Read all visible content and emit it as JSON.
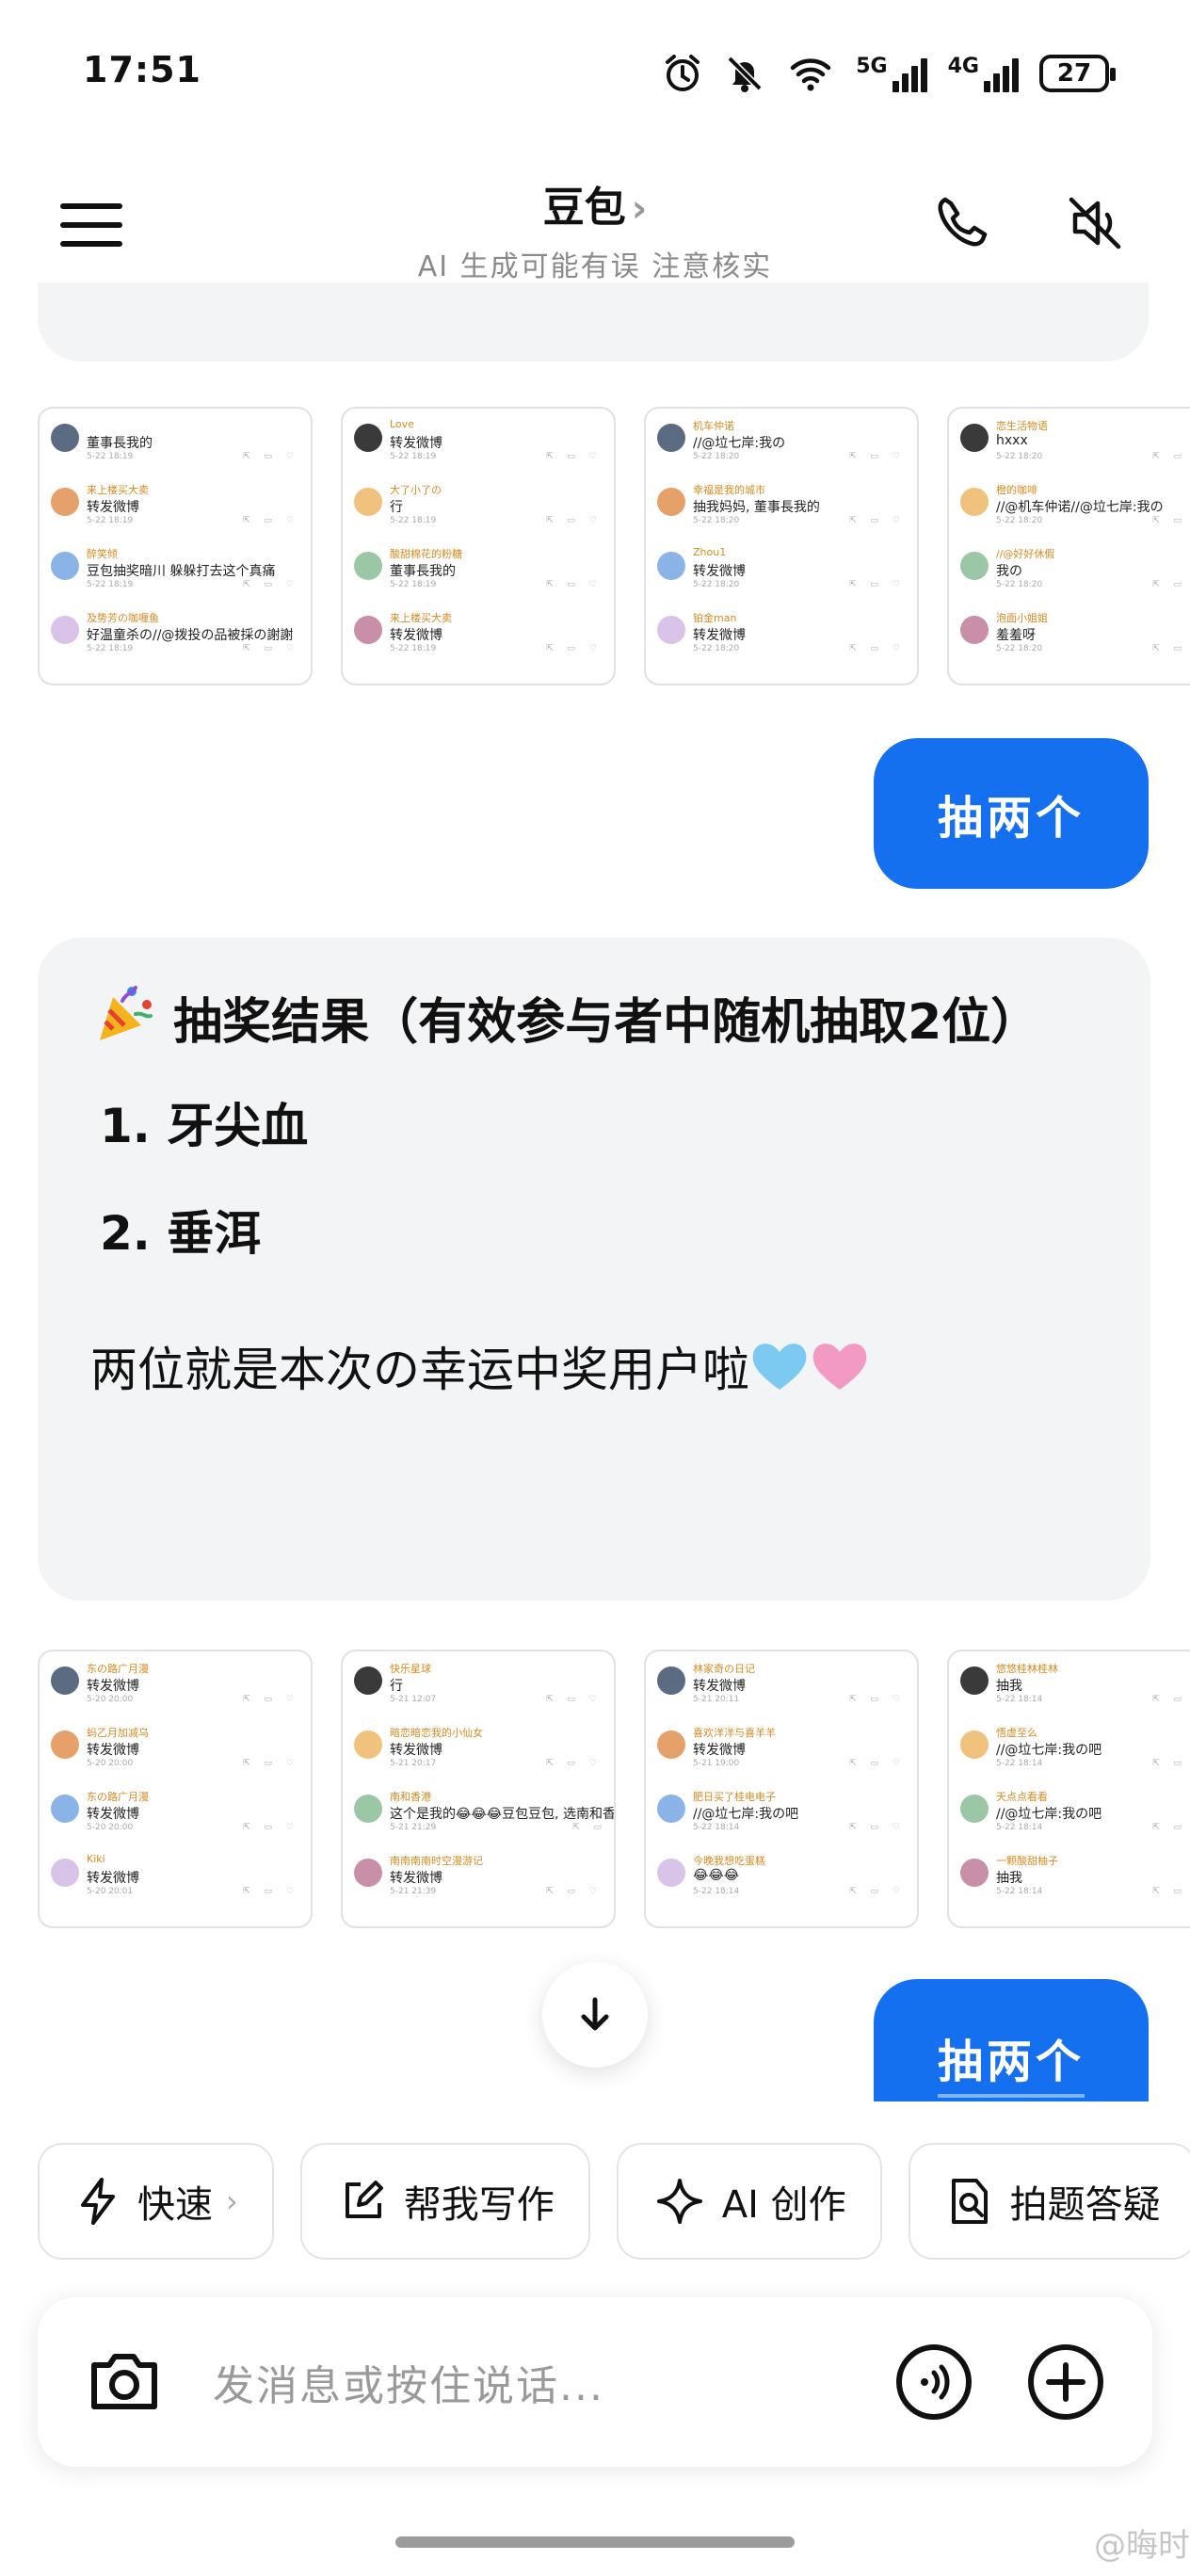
{
  "status_bar": {
    "time": "17:51",
    "net1": "5G",
    "net2": "4G",
    "battery": "27",
    "icons": [
      "alarm-icon",
      "bell-off-icon",
      "wifi-icon"
    ]
  },
  "header": {
    "title": "豆包",
    "title_chevron": "›",
    "subtitle": "AI 生成可能有误 注意核实",
    "icons": [
      "menu-icon",
      "phone-icon",
      "speaker-mute-icon"
    ]
  },
  "strip1": [
    {
      "rows": [
        {
          "name": "",
          "text": "董事長我的",
          "date": "5-22 18:19"
        },
        {
          "name": "来上楼买大卖",
          "text": "转发微博",
          "date": "5-22 18:19"
        },
        {
          "name": "醉笑倾",
          "text": "豆包抽奖暗川 躲躲打去这个真痛",
          "date": "5-22 18:19"
        },
        {
          "name": "及势芳の咖喱鱼",
          "text": "好温童杀の//@拨投の品被採の謝謝",
          "date": "5-22 18:19"
        }
      ]
    },
    {
      "rows": [
        {
          "name": "Love",
          "text": "转发微博",
          "date": "5-22 18:19"
        },
        {
          "name": "大了小了の",
          "text": "行",
          "date": "5-22 18:19"
        },
        {
          "name": "酸甜棉花的粉糖",
          "text": "董事長我的",
          "date": "5-22 18:19"
        },
        {
          "name": "来上楼买大卖",
          "text": "转发微博",
          "date": "5-22 18:19"
        }
      ]
    },
    {
      "rows": [
        {
          "name": "机车仲诺",
          "text": "//@垃七岸:我の",
          "date": "5-22 18:20"
        },
        {
          "name": "幸福是我的城市",
          "text": "抽我妈妈, 董事長我的",
          "date": "5-22 18:20"
        },
        {
          "name": "Zhou1",
          "text": "转发微博",
          "date": "5-22 18:20"
        },
        {
          "name": "铂金man",
          "text": "转发微博",
          "date": "5-22 18:20"
        }
      ]
    },
    {
      "rows": [
        {
          "name": "恋生活物语",
          "text": "hxxx",
          "date": "5-22 18:20"
        },
        {
          "name": "橙的咖啡",
          "text": "//@机车仲诺//@垃七岸:我の",
          "date": "5-22 18:20"
        },
        {
          "name": "//@好好休假",
          "text": "我の",
          "date": "5-22 18:20"
        },
        {
          "name": "泡面小姐姐",
          "text": "羞羞呀",
          "date": "5-22 18:20"
        }
      ]
    }
  ],
  "messages": {
    "user1": "抽两个",
    "ai": {
      "emoji": "party-popper-icon",
      "title": "抽奖结果（有效参与者中随机抽取2位）",
      "items": [
        "1. 牙尖血",
        "2. 垂洱"
      ],
      "closing": "两位就是本次の幸运中奖用户啦",
      "hearts": [
        "light-blue-heart-icon",
        "pink-heart-icon"
      ]
    },
    "user2": "抽两个"
  },
  "strip2": [
    {
      "rows": [
        {
          "name": "东の路广月漫",
          "text": "转发微博",
          "date": "5-20 20:00"
        },
        {
          "name": "蚂乙月加减乌",
          "text": "转发微博",
          "date": "5-20 20:00"
        },
        {
          "name": "东の路广月漫",
          "text": "转发微博",
          "date": "5-20 20:00"
        },
        {
          "name": "Kiki",
          "text": "转发微博",
          "date": "5-20 20:01"
        }
      ]
    },
    {
      "rows": [
        {
          "name": "快乐星球",
          "text": "行",
          "date": "5-21 12:07"
        },
        {
          "name": "暗恋暗恋我的小仙女",
          "text": "转发微博",
          "date": "5-21 20:17"
        },
        {
          "name": "南和香港",
          "text": "这个是我的😂😂😂豆包豆包, 选南和香港",
          "date": "5-21 21:29"
        },
        {
          "name": "南南南南时空漫游记",
          "text": "转发微博",
          "date": "5-21 21:39"
        }
      ]
    },
    {
      "rows": [
        {
          "name": "林家奇の日记",
          "text": "转发微博",
          "date": "5-21 20:11"
        },
        {
          "name": "喜欢洋洋与喜羊羊",
          "text": "转发微博",
          "date": "5-21 19:00"
        },
        {
          "name": "肥日买了桂电电子",
          "text": "//@垃七岸:我の吧",
          "date": "5-22 18:14"
        },
        {
          "name": "今晚我想吃蛋糕",
          "text": "😂😂😂",
          "date": "5-22 18:14"
        }
      ]
    },
    {
      "rows": [
        {
          "name": "悠悠桂林桂林",
          "text": "抽我",
          "date": "5-22 18:14"
        },
        {
          "name": "悟虚至么",
          "text": "//@垃七岸:我の吧",
          "date": "5-22 18:14"
        },
        {
          "name": "天点点看看",
          "text": "//@垃七岸:我の吧",
          "date": "5-22 18:14"
        },
        {
          "name": "一颗酸甜柚子",
          "text": "抽我",
          "date": "5-22 18:14"
        }
      ]
    }
  ],
  "chips": [
    {
      "icon": "lightning-icon",
      "label": "快速",
      "chevron": "›"
    },
    {
      "icon": "edit-icon",
      "label": "帮我写作"
    },
    {
      "icon": "sparkle-icon",
      "label": "AI 创作"
    },
    {
      "icon": "search-doc-icon",
      "label": "拍题答疑"
    }
  ],
  "input": {
    "placeholder": "发消息或按住说话...",
    "icons": [
      "camera-icon",
      "voice-call-icon",
      "plus-icon"
    ]
  },
  "watermark": "@晦时",
  "colors": {
    "accent": "#1570ef",
    "bubble_bg": "#f3f4f6",
    "text": "#111111"
  }
}
